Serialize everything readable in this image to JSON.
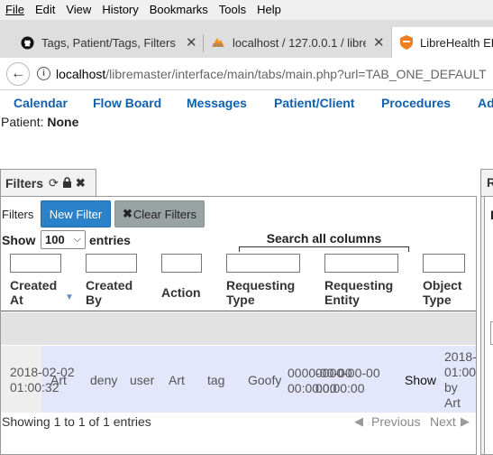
{
  "menubar": {
    "items": [
      "File",
      "Edit",
      "View",
      "History",
      "Bookmarks",
      "Tools",
      "Help"
    ]
  },
  "tabs": [
    {
      "title": "Tags, Patient/Tags, Filters UI",
      "icon": "github-icon"
    },
    {
      "title": "localhost / 127.0.0.1 / libreeh",
      "icon": "phpmyadmin-icon"
    },
    {
      "title": "LibreHealth EHR",
      "icon": "librehealth-icon"
    }
  ],
  "urlbar": {
    "host": "localhost",
    "path": "/libremaster/interface/main/tabs/main.php?url=TAB_ONE_DEFAULT"
  },
  "appnav": {
    "items": [
      "Calendar",
      "Flow Board",
      "Messages",
      "Patient/Client",
      "Procedures",
      "Ad"
    ]
  },
  "patient": {
    "label": "Patient:",
    "value": "None"
  },
  "filters_panel": {
    "title": "Filters",
    "filters_label": "Filters",
    "new_filter_label": "New Filter",
    "clear_filters_label": "Clear Filters",
    "show_label": "Show",
    "page_length": "100",
    "entries_label": "entries",
    "search_all_label": "Search all columns",
    "columns": [
      {
        "line1": "Created",
        "line2": "At"
      },
      {
        "line1": "Created",
        "line2": "By"
      },
      {
        "line1": "Action",
        "line2": ""
      },
      {
        "line1": "Requesting",
        "line2": "Type"
      },
      {
        "line1": "Requesting",
        "line2": "Entity"
      },
      {
        "line1": "Object",
        "line2": "Type"
      }
    ],
    "row": {
      "created_at_1": "2018-02-02",
      "created_at_2": "01:00:32",
      "created_by": "Art",
      "action": "deny",
      "requesting_type": "user",
      "requesting_entity": "Art",
      "object_type": "tag",
      "object_entity": "Goofy",
      "date1_1": "0000-00-00",
      "date1_2": "00:00:00",
      "date2_1": "0000-00-00",
      "date2_2": "00:00:00",
      "show": "Show",
      "last_1": "2018-",
      "last_2": "01:00",
      "last_3": "by",
      "last_4": "Art"
    },
    "info": "Showing 1 to 1 of 1 entries",
    "previous_label": "Previous",
    "next_label": "Next"
  },
  "right_panel": {
    "tab_letter": "R",
    "inner_letter": "F"
  },
  "colors": {
    "link_blue": "#1060b0",
    "new_filter_btn": "#2b82c9",
    "clear_filter_btn": "#9aa3a3",
    "row_bg": "#e4e6fb"
  }
}
